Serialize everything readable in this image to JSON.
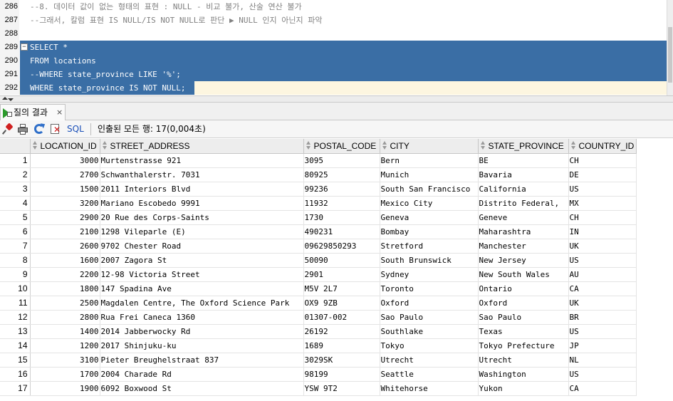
{
  "editor": {
    "lines": [
      {
        "num": "286",
        "text": "--8. 데이터 값이 없는 형태의 표현 : NULL - 비교 불가, 산술 연산 불가",
        "kind": "comment"
      },
      {
        "num": "287",
        "text": "--그래서, 칼럼 표현 IS NULL/IS NOT NULL로 판단 ▶ NULL 인지 아닌지 파악",
        "kind": "comment"
      },
      {
        "num": "288",
        "text": "",
        "kind": "blank"
      },
      {
        "num": "289",
        "text": "SELECT *",
        "kind": "selected"
      },
      {
        "num": "290",
        "text": "FROM locations",
        "kind": "selected"
      },
      {
        "num": "291",
        "text": "--WHERE state_province LIKE '%';",
        "kind": "selected"
      },
      {
        "num": "292",
        "text": "WHERE state_province IS NOT NULL;",
        "kind": "selected-last"
      }
    ],
    "fold_symbol": "−"
  },
  "tab": {
    "label": "질의 결과",
    "close": "×"
  },
  "toolbar": {
    "sql_label": "SQL",
    "separator": "|",
    "status": "인출된 모든 행: 17(0,004초)"
  },
  "grid": {
    "columns": [
      "LOCATION_ID",
      "STREET_ADDRESS",
      "POSTAL_CODE",
      "CITY",
      "STATE_PROVINCE",
      "COUNTRY_ID"
    ],
    "rows": [
      [
        "1",
        "3000",
        "Murtenstrasse 921",
        "3095",
        "Bern",
        "BE",
        "CH"
      ],
      [
        "2",
        "2700",
        "Schwanthalerstr. 7031",
        "80925",
        "Munich",
        "Bavaria",
        "DE"
      ],
      [
        "3",
        "1500",
        "2011 Interiors Blvd",
        "99236",
        "South San Francisco",
        "California",
        "US"
      ],
      [
        "4",
        "3200",
        "Mariano Escobedo 9991",
        "11932",
        "Mexico City",
        "Distrito Federal,",
        "MX"
      ],
      [
        "5",
        "2900",
        "20 Rue des Corps-Saints",
        "1730",
        "Geneva",
        "Geneve",
        "CH"
      ],
      [
        "6",
        "2100",
        "1298 Vileparle (E)",
        "490231",
        "Bombay",
        "Maharashtra",
        "IN"
      ],
      [
        "7",
        "2600",
        "9702 Chester Road",
        "09629850293",
        "Stretford",
        "Manchester",
        "UK"
      ],
      [
        "8",
        "1600",
        "2007 Zagora St",
        "50090",
        "South Brunswick",
        "New Jersey",
        "US"
      ],
      [
        "9",
        "2200",
        "12-98 Victoria Street",
        "2901",
        "Sydney",
        "New South Wales",
        "AU"
      ],
      [
        "10",
        "1800",
        "147 Spadina Ave",
        "M5V 2L7",
        "Toronto",
        "Ontario",
        "CA"
      ],
      [
        "11",
        "2500",
        "Magdalen Centre, The Oxford Science Park",
        "OX9 9ZB",
        "Oxford",
        "Oxford",
        "UK"
      ],
      [
        "12",
        "2800",
        "Rua Frei Caneca 1360",
        "01307-002",
        "Sao Paulo",
        "Sao Paulo",
        "BR"
      ],
      [
        "13",
        "1400",
        "2014 Jabberwocky Rd",
        "26192",
        "Southlake",
        "Texas",
        "US"
      ],
      [
        "14",
        "1200",
        "2017 Shinjuku-ku",
        "1689",
        "Tokyo",
        "Tokyo Prefecture",
        "JP"
      ],
      [
        "15",
        "3100",
        "Pieter Breughelstraat 837",
        "3029SK",
        "Utrecht",
        "Utrecht",
        "NL"
      ],
      [
        "16",
        "1700",
        "2004 Charade Rd",
        "98199",
        "Seattle",
        "Washington",
        "US"
      ],
      [
        "17",
        "1900",
        "6092 Boxwood St",
        "YSW 9T2",
        "Whitehorse",
        "Yukon",
        "CA"
      ]
    ]
  },
  "colors": {
    "selection": "#3a6ea5",
    "comment": "#808080",
    "run_icon": "#2c9a2c",
    "sql_link": "#1a4fb8"
  }
}
